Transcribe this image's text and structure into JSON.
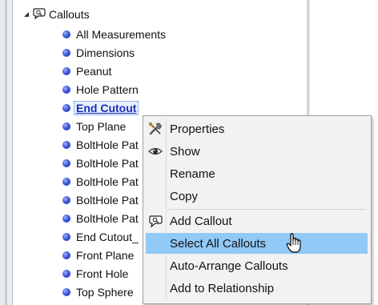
{
  "tree": {
    "root": {
      "label": "Callouts",
      "icon": "callout-group-icon"
    },
    "items": [
      {
        "label": "All Measurements"
      },
      {
        "label": "Dimensions"
      },
      {
        "label": "Peanut"
      },
      {
        "label": "Hole Pattern"
      },
      {
        "label": "End Cutout",
        "selected": true
      },
      {
        "label": "Top Plane"
      },
      {
        "label": "BoltHole Pat"
      },
      {
        "label": "BoltHole Pat"
      },
      {
        "label": "BoltHole Pat"
      },
      {
        "label": "BoltHole Pat"
      },
      {
        "label": "BoltHole Pat"
      },
      {
        "label": "End Cutout_"
      },
      {
        "label": "Front Plane"
      },
      {
        "label": "Front Hole"
      },
      {
        "label": "Top Sphere"
      }
    ]
  },
  "context_menu": {
    "items": [
      {
        "label": "Properties",
        "icon": "tools-icon"
      },
      {
        "label": "Show",
        "icon": "eye-icon"
      },
      {
        "label": "Rename",
        "icon": ""
      },
      {
        "label": "Copy",
        "icon": ""
      },
      {
        "label": "Add Callout",
        "icon": "callout-icon"
      },
      {
        "label": "Select All Callouts",
        "icon": "",
        "highlighted": true
      },
      {
        "label": "Auto-Arrange Callouts",
        "icon": ""
      },
      {
        "label": "Add to Relationship",
        "icon": ""
      }
    ]
  },
  "colors": {
    "highlight": "#91c9f7",
    "bullet": "#3f58d8",
    "selected_text": "#1b2db3"
  }
}
